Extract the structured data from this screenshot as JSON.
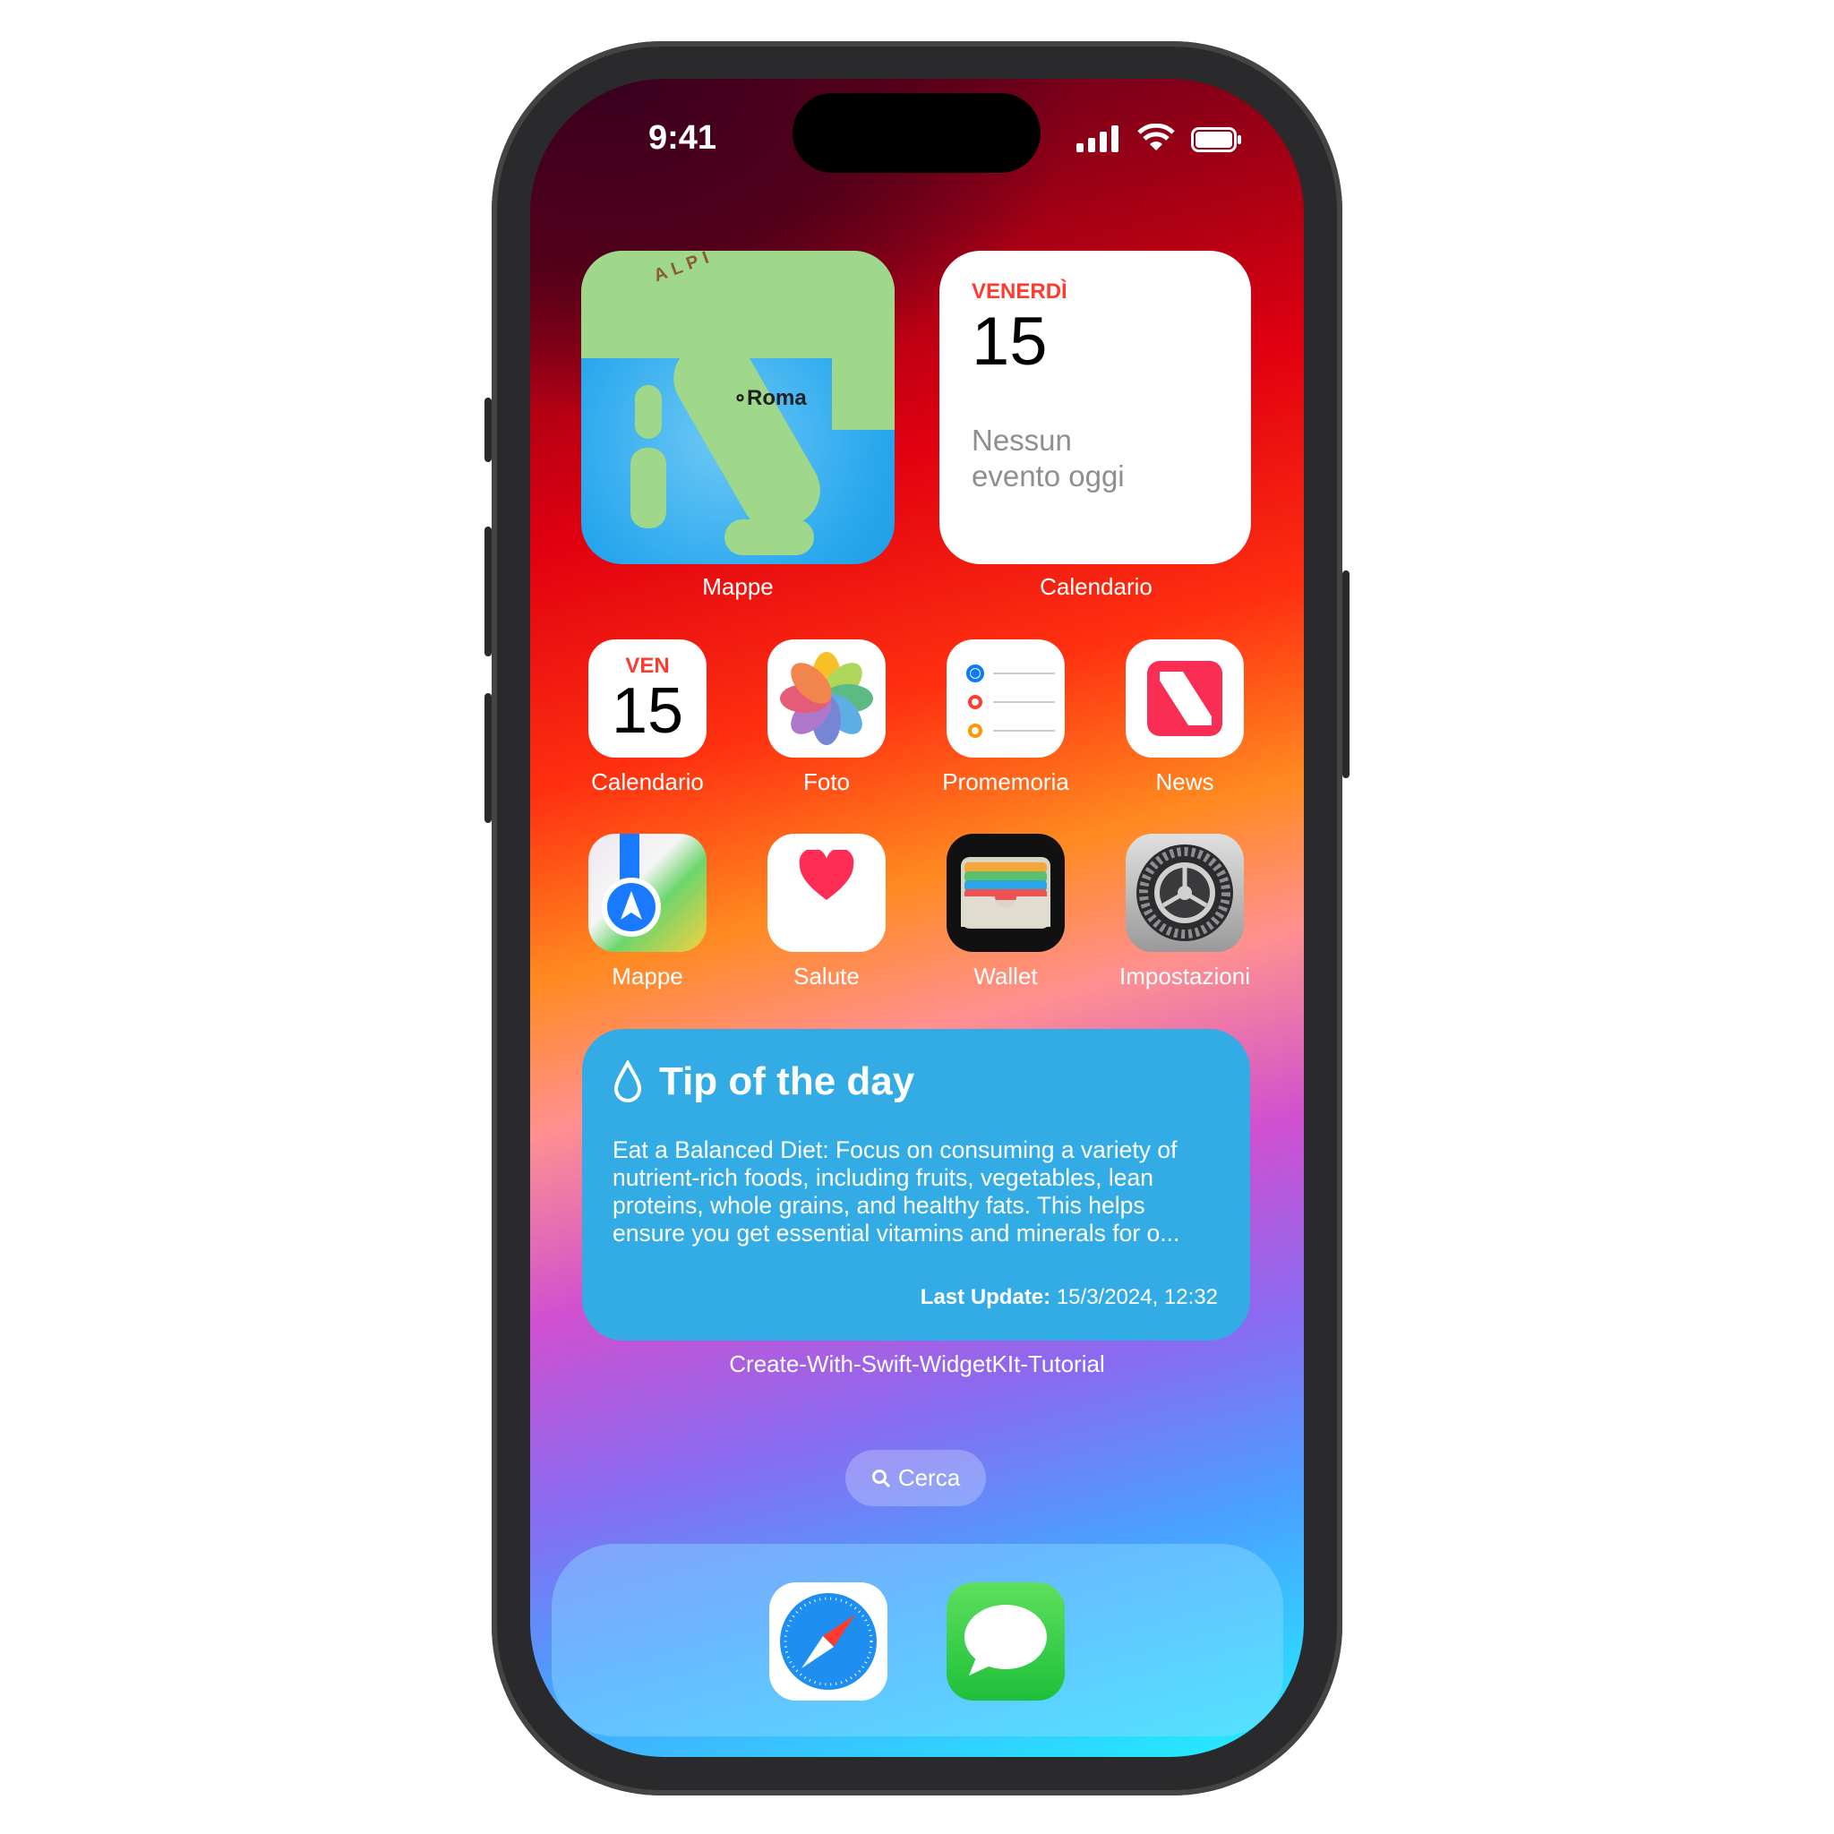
{
  "status_bar": {
    "time": "9:41",
    "icons": [
      "signal-icon",
      "wifi-icon",
      "battery-icon"
    ]
  },
  "widgets": {
    "maps": {
      "label": "Mappe",
      "city": "Roma",
      "region_label": "ALPI"
    },
    "calendar": {
      "label": "Calendario",
      "weekday": "VENERDÌ",
      "day": "15",
      "no_events": "Nessun evento oggi"
    }
  },
  "apps": [
    {
      "label": "Calendario",
      "icon_weekday": "VEN",
      "icon_day": "15"
    },
    {
      "label": "Foto"
    },
    {
      "label": "Promemoria"
    },
    {
      "label": "News"
    },
    {
      "label": "Mappe"
    },
    {
      "label": "Salute"
    },
    {
      "label": "Wallet"
    },
    {
      "label": "Impostazioni"
    }
  ],
  "tip_widget": {
    "title": "Tip of the day",
    "body": "Eat a Balanced Diet: Focus on consuming a variety of nutrient-rich foods, including fruits, vegetables, lean proteins, whole grains, and healthy fats. This helps ensure you get essential vitamins and minerals for o...",
    "update_label": "Last Update:",
    "update_value": "15/3/2024, 12:32",
    "label": "Create-With-Swift-WidgetKIt-Tutorial",
    "color": "#33ace6"
  },
  "search": {
    "label": "Cerca"
  },
  "dock": [
    "safari-icon",
    "messages-icon"
  ]
}
